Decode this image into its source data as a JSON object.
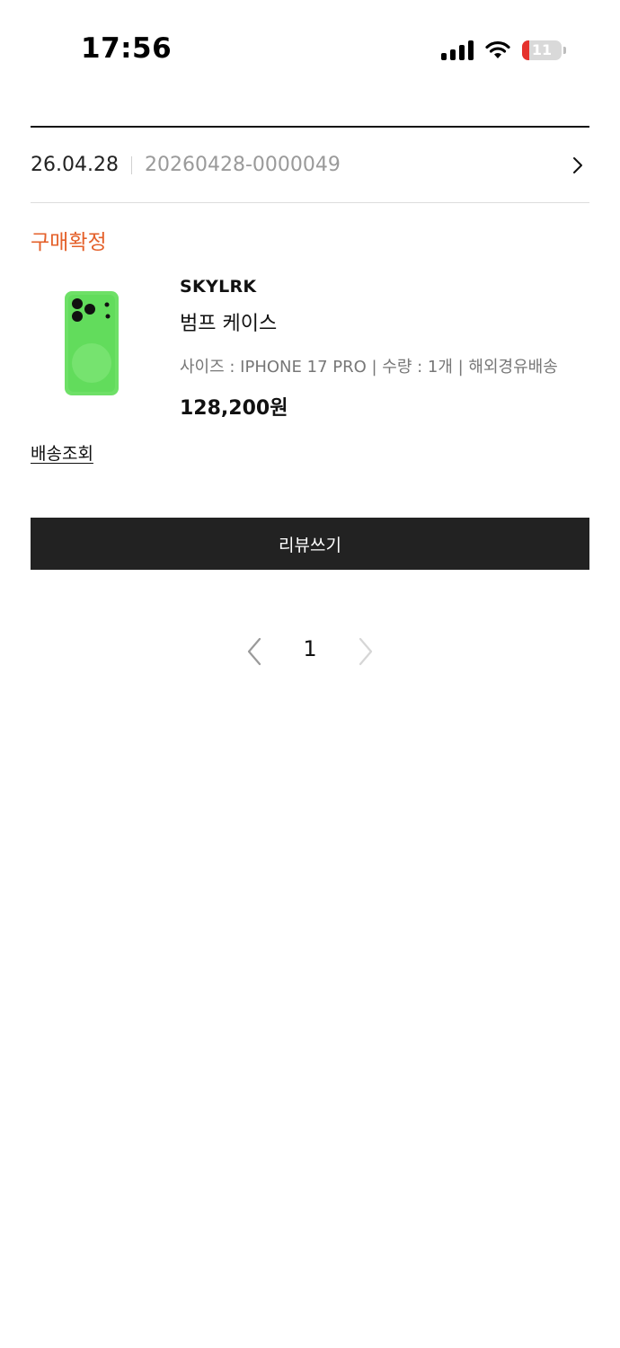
{
  "status_bar": {
    "time": "17:56",
    "battery_level": "11",
    "icons": [
      "signal-icon",
      "wifi-icon",
      "battery-icon"
    ]
  },
  "order": {
    "date": "26.04.28",
    "number": "20260428-0000049",
    "status": "구매확정"
  },
  "product": {
    "brand": "SKYLRK",
    "name": "범프 케이스",
    "options": "사이즈 : IPHONE 17 PRO | 수량 : 1개 | 해외경유배송",
    "price": "128,200원",
    "image": "green-phone-case-image"
  },
  "actions": {
    "track_label": "배송조회",
    "review_label": "리뷰쓰기"
  },
  "pagination": {
    "current_page": "1"
  },
  "colors": {
    "status_accent": "#e4602a",
    "button_bg": "#222222",
    "battery_low": "#e5322d"
  }
}
